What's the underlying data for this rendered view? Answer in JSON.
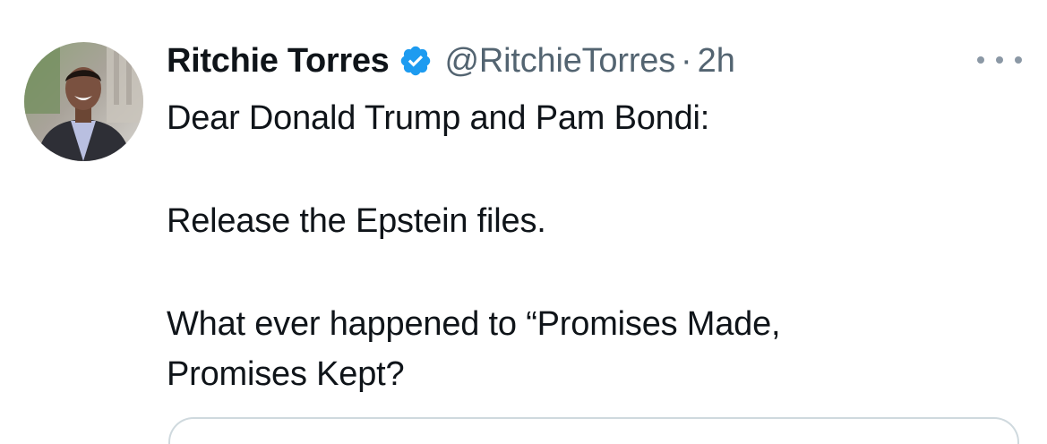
{
  "tweet": {
    "author_name": "Ritchie Torres",
    "handle": "@RitchieTorres",
    "separator": "·",
    "time": "2h",
    "verified_icon": "verified-badge-icon",
    "more_icon": "more-horizontal-icon",
    "avatar_icon": "avatar-photo",
    "text": {
      "line1": "Dear Donald Trump and Pam Bondi:",
      "line2": "Release the Epstein files.",
      "line3": "What ever happened to “Promises Made,",
      "line4": "Promises Kept?"
    }
  },
  "colors": {
    "text_primary": "#0f1419",
    "text_secondary": "#536471",
    "verified_blue": "#1d9bf0",
    "border": "#cfd9de"
  }
}
